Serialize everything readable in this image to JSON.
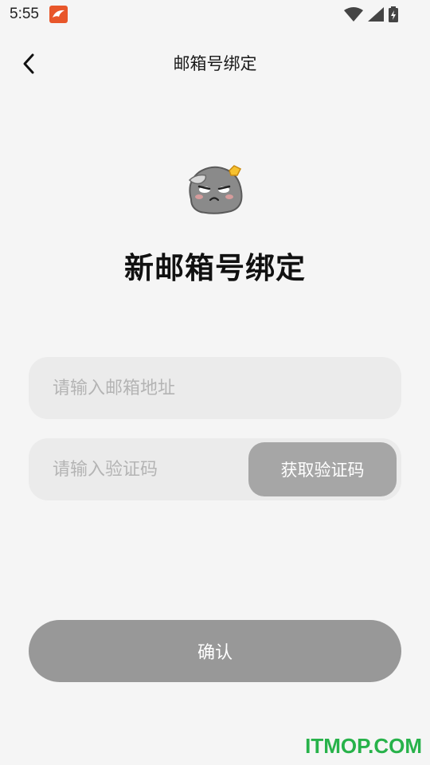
{
  "status_bar": {
    "time": "5:55"
  },
  "nav": {
    "title": "邮箱号绑定",
    "back_icon": "chevron-left-icon"
  },
  "main": {
    "mascot_icon": "grumpy-rock-mascot-icon",
    "headline": "新邮箱号绑定",
    "email_placeholder": "请输入邮箱地址",
    "code_placeholder": "请输入验证码",
    "get_code_label": "获取验证码",
    "confirm_label": "确认"
  },
  "watermark": "ITMOP.COM",
  "colors": {
    "background": "#f5f5f5",
    "field": "#ebebeb",
    "code_button": "#a6a6a6",
    "confirm_button": "#989898",
    "watermark": "#27b24a"
  }
}
